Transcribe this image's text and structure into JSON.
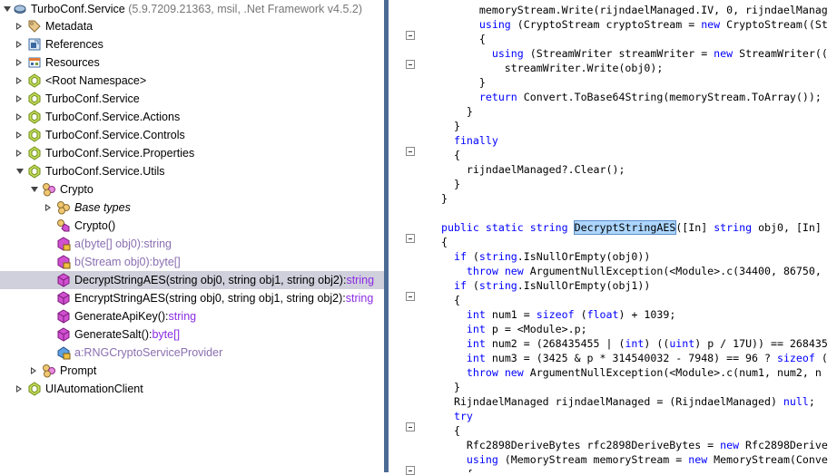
{
  "tree": {
    "root_name": "TurboConf.Service",
    "root_version": "(5.9.7209.21363, msil, .Net Framework v4.5.2)",
    "metadata": "Metadata",
    "references": "References",
    "resources": "Resources",
    "root_namespace": "<Root Namespace>",
    "ns_service": "TurboConf.Service",
    "ns_actions": "TurboConf.Service.Actions",
    "ns_controls": "TurboConf.Service.Controls",
    "ns_properties": "TurboConf.Service.Properties",
    "ns_utils": "TurboConf.Service.Utils",
    "crypto": "Crypto",
    "base_types": "Base types",
    "ctor": "Crypto()",
    "m_a": "a(byte[] obj0):string",
    "m_b": "b(Stream obj0):byte[]",
    "m_decrypt_name": "DecryptStringAES(string obj0, string obj1, string obj2):",
    "m_decrypt_type": "string",
    "m_encrypt_name": "EncryptStringAES(string obj0, string obj1, string obj2):",
    "m_encrypt_type": "string",
    "m_apikey_name": "GenerateApiKey():",
    "m_apikey_type": "string",
    "m_salt_name": "GenerateSalt():",
    "m_salt_type": "byte[]",
    "f_rng": "a:RNGCryptoServiceProvider",
    "prompt": "Prompt",
    "uiautomation": "UIAutomationClient"
  },
  "code": {
    "lines": [
      "      memoryStream.Write(rijndaelManaged.IV, 0, rijndaelManag",
      "      using (CryptoStream cryptoStream = new CryptoStream((St",
      "      {",
      "        using (StreamWriter streamWriter = new StreamWriter((",
      "          streamWriter.Write(obj0);",
      "      }",
      "      return Convert.ToBase64String(memoryStream.ToArray());",
      "    }",
      "  }",
      "  finally",
      "  {",
      "    rijndaelManaged?.Clear();",
      "  }",
      "}",
      "",
      "public static string DecryptStringAES([In] string obj0, [In]",
      "{",
      "  if (string.IsNullOrEmpty(obj0))",
      "    throw new ArgumentNullException(<Module>.c(34400, 86750,",
      "  if (string.IsNullOrEmpty(obj1))",
      "  {",
      "    int num1 = sizeof (float) + 1039;",
      "    int p = <Module>.p;",
      "    int num2 = (268435455 | (int) ((uint) p / 17U)) == 268435",
      "    int num3 = (3425 & p * 314540032 - 7948) == 96 ? sizeof (",
      "    throw new ArgumentNullException(<Module>.c(num1, num2, n",
      "  }",
      "  RijndaelManaged rijndaelManaged = (RijndaelManaged) null;",
      "  try",
      "  {",
      "    Rfc2898DeriveBytes rfc2898DeriveBytes = new Rfc2898Derive",
      "    using (MemoryStream memoryStream = new MemoryStream(Conve",
      "    {"
    ]
  }
}
